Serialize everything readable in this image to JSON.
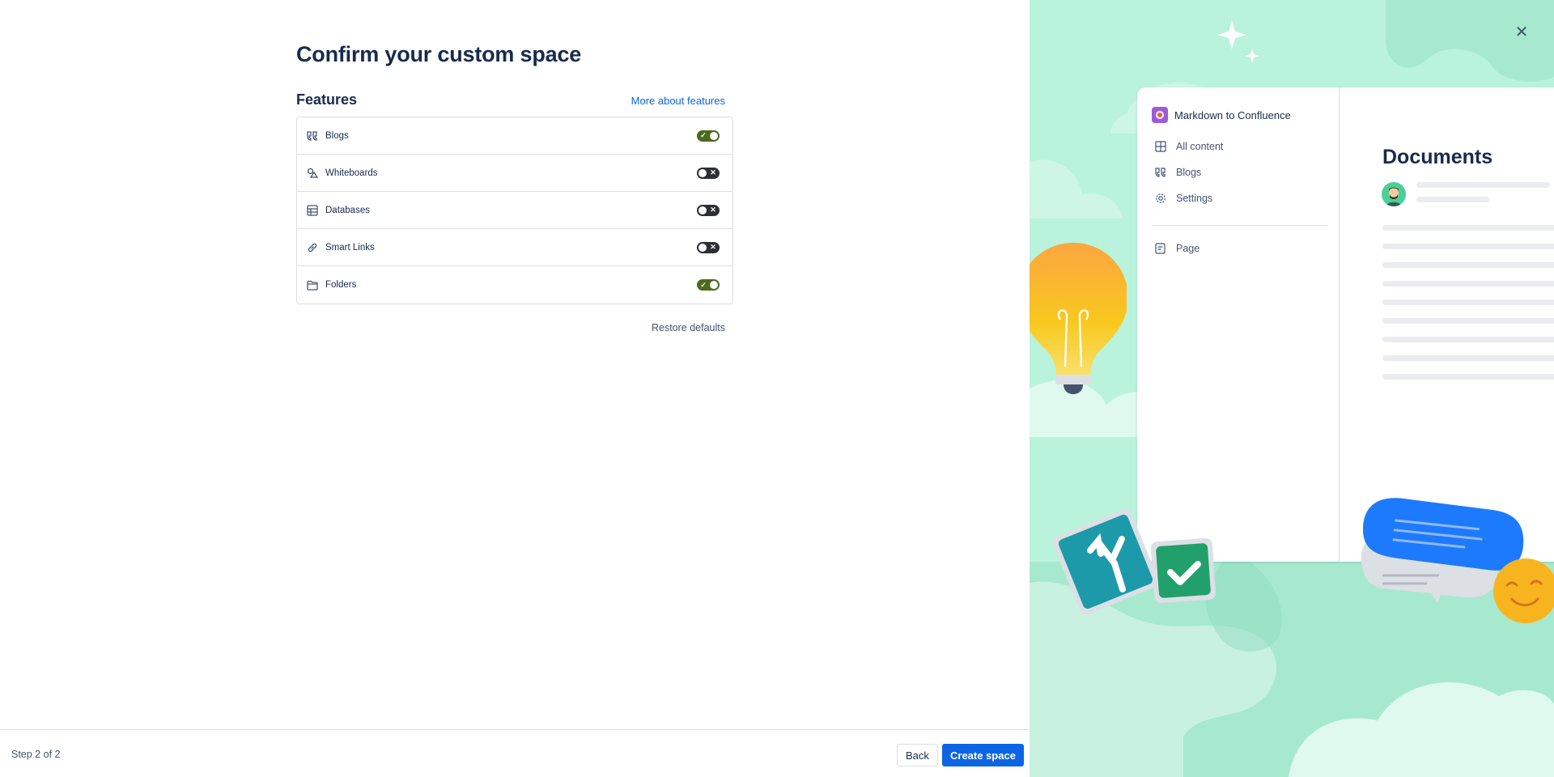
{
  "left": {
    "title": "Confirm your custom space",
    "features_title": "Features",
    "more_link": "More about features",
    "features": [
      {
        "label": "Blogs",
        "icon": "quote-icon",
        "enabled": true
      },
      {
        "label": "Whiteboards",
        "icon": "shapes-icon",
        "enabled": false
      },
      {
        "label": "Databases",
        "icon": "table-icon",
        "enabled": false
      },
      {
        "label": "Smart Links",
        "icon": "link-icon",
        "enabled": false
      },
      {
        "label": "Folders",
        "icon": "folder-icon",
        "enabled": true
      }
    ],
    "restore": "Restore defaults"
  },
  "footer": {
    "step": "Step 2 of 2",
    "back": "Back",
    "create": "Create space"
  },
  "preview": {
    "space_name": "Markdown to Confluence",
    "nav": [
      "All content",
      "Blogs",
      "Settings"
    ],
    "nav_page": "Page",
    "doc_title": "Documents"
  },
  "colors": {
    "accent": "#0c66e4",
    "toggle_on": "#4c6b1f",
    "toggle_off": "#2c2f33",
    "illustration_bg": "#baf3db"
  }
}
